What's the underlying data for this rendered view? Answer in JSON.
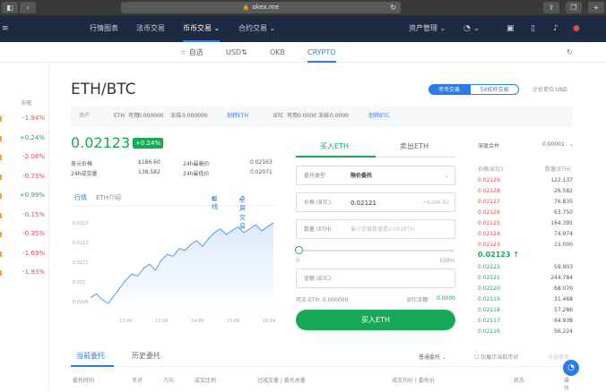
{
  "browser": {
    "url": "okex.me",
    "lock_icon": "lock-icon"
  },
  "nav": {
    "items": [
      "行情图表",
      "法币交易",
      "币币交易",
      "合约交易"
    ],
    "asset_mgmt": "资产管理"
  },
  "subtabs": [
    "自选",
    "USD⇅",
    "OKB",
    "CRYPTO"
  ],
  "left_list": {
    "header": "涨幅",
    "rows": [
      {
        "value": "-1.94%",
        "dir": "down"
      },
      {
        "value": "+0.24%",
        "dir": "up"
      },
      {
        "value": "-2.06%",
        "dir": "down"
      },
      {
        "value": "-0.73%",
        "dir": "down"
      },
      {
        "value": "+0.99%",
        "dir": "up"
      },
      {
        "value": "-0.15%",
        "dir": "down"
      },
      {
        "value": "-0.35%",
        "dir": "down"
      },
      {
        "value": "-1.69%",
        "dir": "down"
      },
      {
        "value": "-1.93%",
        "dir": "down"
      }
    ]
  },
  "pair": {
    "title": "ETH/BTC",
    "mode_coin": "币币交易",
    "mode_margin": "5X杠杆交易",
    "unit_label": "计价单位",
    "unit": "USD"
  },
  "assets": {
    "label": "资产",
    "eth": "ETH",
    "avail_label": "可用",
    "eth_avail": "0.000000",
    "frozen_label": "冻结",
    "eth_frozen": "0.000000",
    "eth_link": "划转ETH",
    "btc": "BTC",
    "btc_avail": "0.0000",
    "btc_frozen": "0.0000",
    "btc_link": "划转BTC"
  },
  "ticker": {
    "price": "0.02123",
    "change": "+0.24%",
    "usd_label": "美元价格",
    "usd_value": "$186.60",
    "vol_label": "24h成交量",
    "vol_value": "138,582",
    "high_label": "24h最高价",
    "high_value": "0.02163",
    "low_label": "24h最低价",
    "low_value": "0.02071"
  },
  "chart_tabs": {
    "tab_market": "行情",
    "tab_eth": "ETH介绍",
    "kline": "K线",
    "full": "全屏交易"
  },
  "chart_data": {
    "type": "line",
    "x": [
      "12:00",
      "13:00",
      "14:00",
      "15:00",
      "16:00"
    ],
    "y_ticks": [
      "0.0213",
      "0.0212",
      "0.0211",
      "0.021",
      "0.0209"
    ],
    "ylim": [
      0.02085,
      0.02135
    ],
    "values": [
      0.02092,
      0.02094,
      0.02091,
      0.02089,
      0.02093,
      0.02097,
      0.02101,
      0.02104,
      0.02103,
      0.02107,
      0.02109,
      0.02106,
      0.02111,
      0.02114,
      0.02113,
      0.02117,
      0.02116,
      0.02119,
      0.02121,
      0.02118,
      0.02122,
      0.02125,
      0.02127,
      0.02124,
      0.02126,
      0.02128,
      0.02125,
      0.02127,
      0.02129,
      0.02126,
      0.02128,
      0.0213
    ]
  },
  "order_form": {
    "buy_tab": "买入ETH",
    "sell_tab": "卖出ETH",
    "type_label": "委托类型",
    "type_value": "限价委托",
    "price_label": "价格 (BTC)",
    "price_value": "0.02121",
    "price_usd": "≈$186.42",
    "qty_label": "数量 (ETH)",
    "qty_placeholder": "最小交易数量是0.001ETH",
    "pct_min": "0",
    "pct_max": "100%",
    "amount_label": "金额 (BTC)",
    "avail_eth": "可买 ETH: 0.000000",
    "avail_btc_label": "BTC余额:",
    "avail_btc": "0.0000",
    "buy_button": "买入ETH",
    "slider_value": 0
  },
  "orderbook": {
    "merge_label": "深度合并",
    "merge_value": "0.00001",
    "price_head": "价格(BTC)",
    "qty_head": "数量(ETH)",
    "asks": [
      {
        "p": "0.02129",
        "q": "122.137"
      },
      {
        "p": "0.02128",
        "q": "26.582"
      },
      {
        "p": "0.02127",
        "q": "76.835"
      },
      {
        "p": "0.02126",
        "q": "63.750"
      },
      {
        "p": "0.02125",
        "q": "164.395"
      },
      {
        "p": "0.02124",
        "q": "74.974"
      },
      {
        "p": "0.02123",
        "q": "15.000"
      }
    ],
    "last": "0.02123 ↑",
    "bids": [
      {
        "p": "0.02122",
        "q": "59.903"
      },
      {
        "p": "0.02121",
        "q": "244.784"
      },
      {
        "p": "0.02120",
        "q": "68.070"
      },
      {
        "p": "0.02119",
        "q": "31.468"
      },
      {
        "p": "0.02118",
        "q": "57.286"
      },
      {
        "p": "0.02117",
        "q": "64.938"
      },
      {
        "p": "0.02116",
        "q": "56.224"
      }
    ]
  },
  "orders": {
    "current": "当前委托",
    "history": "历史委托",
    "filter": "普通委托",
    "only_current": "仅展示当前币对",
    "cancel_all": "全部撤单",
    "cols": [
      "委托时间",
      "币对",
      "方向",
      "成交比例",
      "已成交量 | 委托总量",
      "成交均价 | 委托价",
      "状态",
      "操作"
    ]
  }
}
